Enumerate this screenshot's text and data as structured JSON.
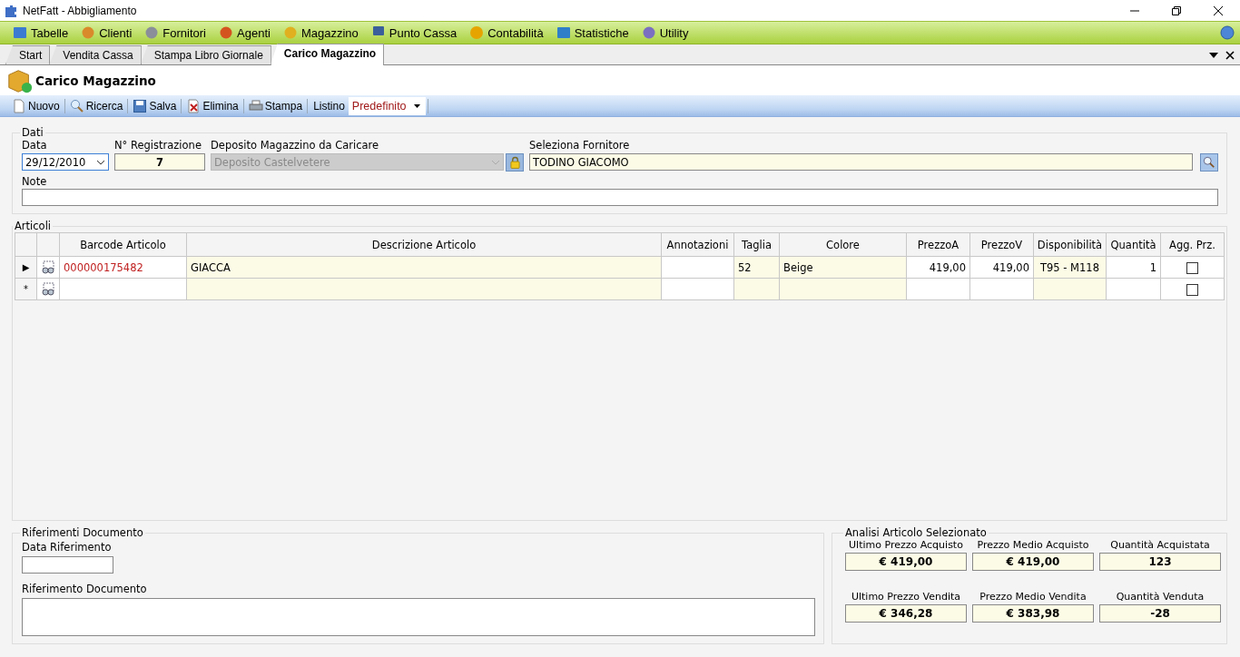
{
  "window": {
    "title": "NetFatt - Abbigliamento"
  },
  "menu": [
    {
      "label": "Tabelle"
    },
    {
      "label": "Clienti"
    },
    {
      "label": "Fornitori"
    },
    {
      "label": "Agenti"
    },
    {
      "label": "Magazzino"
    },
    {
      "label": "Punto Cassa"
    },
    {
      "label": "Contabilità"
    },
    {
      "label": "Statistiche"
    },
    {
      "label": "Utility"
    }
  ],
  "tabs": [
    {
      "label": "Start",
      "selected": false
    },
    {
      "label": "Vendita Cassa",
      "selected": false
    },
    {
      "label": "Stampa Libro Giornale",
      "selected": false
    },
    {
      "label": "Carico Magazzino",
      "selected": true
    }
  ],
  "page": {
    "title": "Carico Magazzino"
  },
  "toolbar": {
    "buttons": [
      {
        "label": "Nuovo"
      },
      {
        "label": "Ricerca"
      },
      {
        "label": "Salva"
      },
      {
        "label": "Elimina"
      },
      {
        "label": "Stampa"
      }
    ],
    "listino": {
      "label": "Listino",
      "value": "Predefinito"
    }
  },
  "dati": {
    "legend": "Dati",
    "data": {
      "label": "Data",
      "value": "29/12/2010"
    },
    "registrazione": {
      "label": "N° Registrazione",
      "value": "7"
    },
    "deposito": {
      "label": "Deposito Magazzino da Caricare",
      "value": "Deposito Castelvetere",
      "disabled": true
    },
    "fornitore": {
      "label": "Seleziona Fornitore",
      "value": "TODINO GIACOMO"
    },
    "note": {
      "label": "Note"
    }
  },
  "articoli": {
    "legend": "Articoli",
    "columns": [
      {
        "label": "Barcode Articolo",
        "tinted": false
      },
      {
        "label": "Descrizione Articolo",
        "tinted": true
      },
      {
        "label": "Annotazioni",
        "tinted": false
      },
      {
        "label": "Taglia",
        "tinted": true
      },
      {
        "label": "Colore",
        "tinted": true
      },
      {
        "label": "PrezzoA",
        "tinted": false
      },
      {
        "label": "PrezzoV",
        "tinted": false
      },
      {
        "label": "Disponibilità",
        "tinted": true
      },
      {
        "label": "Quantità",
        "tinted": false
      },
      {
        "label": "Agg. Prz.",
        "tinted": false
      }
    ],
    "rows": [
      {
        "marker": "▶",
        "cells": [
          "000000175482",
          "GIACCA",
          "",
          "52",
          "Beige",
          "419,00",
          "419,00",
          "T95 - M118",
          "1"
        ],
        "checked": false
      },
      {
        "marker": "*",
        "checked": false
      }
    ]
  },
  "riferimenti": {
    "legend": "Riferimenti Documento",
    "data_label": "Data Riferimento",
    "documento_label": "Riferimento Documento"
  },
  "analisi": {
    "legend": "Analisi Articolo Selezionato",
    "stats": [
      {
        "label": "Ultimo Prezzo Acquisto",
        "value": "€ 419,00"
      },
      {
        "label": "Prezzo Medio Acquisto",
        "value": "€ 419,00"
      },
      {
        "label": "Quantità Acquistata",
        "value": "123"
      },
      {
        "label": "Ultimo Prezzo Vendita",
        "value": "€ 346,28"
      },
      {
        "label": "Prezzo Medio Vendita",
        "value": "€ 383,98"
      },
      {
        "label": "Quantità Venduta",
        "value": "-28"
      }
    ]
  }
}
